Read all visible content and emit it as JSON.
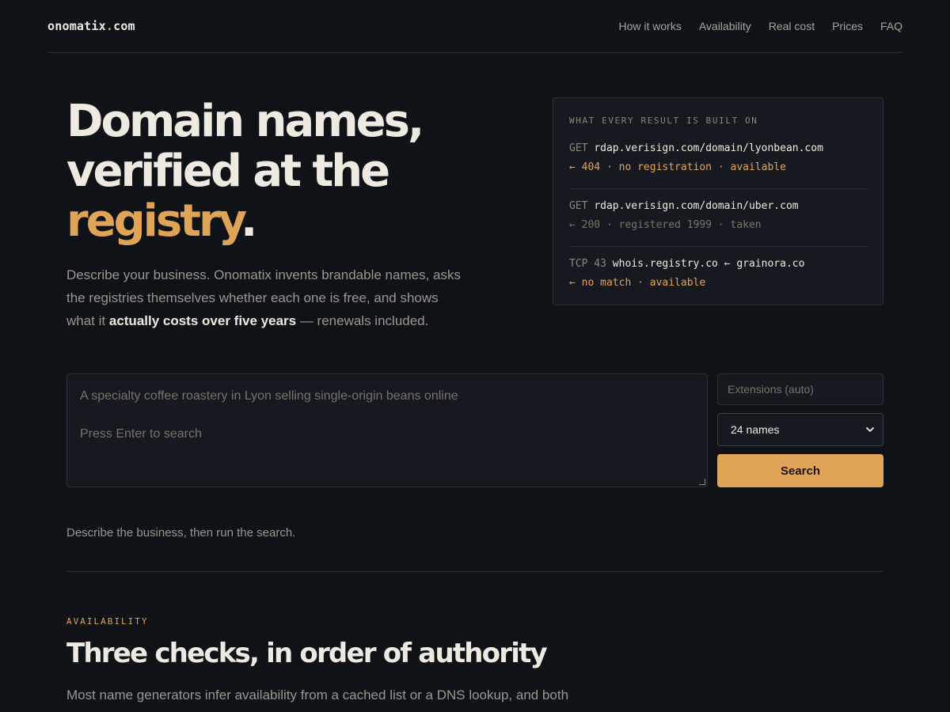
{
  "nav": {
    "logo_name": "onomatix",
    "logo_dot": ".",
    "logo_tld": "com",
    "links": [
      "How it works",
      "Availability",
      "Real cost",
      "Prices",
      "FAQ"
    ]
  },
  "hero": {
    "title_line1": "Domain names,",
    "title_line2": "verified at the",
    "title_accent": "registry",
    "title_period": ".",
    "desc_before": "Describe your business. Onomatix invents brandable names, asks the registries themselves whether each one is free, and shows what it ",
    "desc_strong": "actually costs over five years",
    "desc_after": " — renewals included."
  },
  "panel": {
    "label": "WHAT EVERY RESULT IS BUILT ON",
    "entries": [
      {
        "method": "GET ",
        "target": "rdap.verisign.com/domain/lyonbean.com",
        "target_extra": "",
        "result": "← 404 · no registration · available"
      },
      {
        "method": "GET ",
        "target": "rdap.verisign.com/domain/uber.com",
        "target_extra": "",
        "result": "← 200 · registered 1999 · taken"
      },
      {
        "method": "TCP 43 ",
        "target": "whois.registry.co",
        "target_extra": " ← grainora.co",
        "result": "← no match · available"
      }
    ]
  },
  "search": {
    "placeholder_line1": "A specialty coffee roastery in Lyon selling single-origin beans online",
    "placeholder_line2": "Press Enter to search",
    "extensions_placeholder": "Extensions (auto)",
    "count_selected": "24 names",
    "button_label": "Search",
    "hint": "Describe the business, then run the search."
  },
  "availability": {
    "eyebrow": "AVAILABILITY",
    "title": "Three checks, in order of authority",
    "desc": "Most name generators infer availability from a cached list or a DNS lookup, and both"
  },
  "colors": {
    "background": "#0f1216",
    "accent": "#e0a456",
    "panel": "#161a20",
    "text": "#eeeae2",
    "muted": "#9b978f"
  }
}
